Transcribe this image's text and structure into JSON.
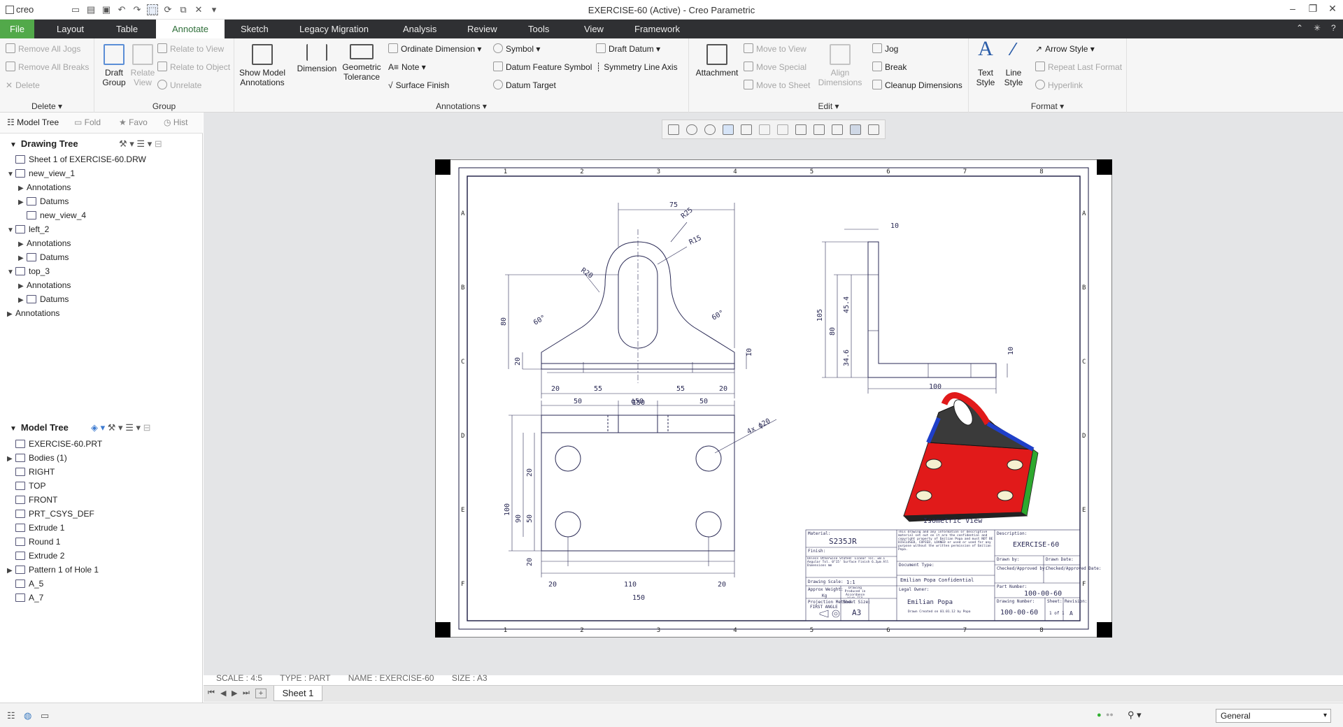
{
  "app": {
    "logo": "creo",
    "window_title": "EXERCISE-60 (Active) - Creo Parametric"
  },
  "ribbon_tabs": {
    "file": "File",
    "layout": "Layout",
    "table": "Table",
    "annotate": "Annotate",
    "sketch": "Sketch",
    "legacy": "Legacy Migration",
    "analysis": "Analysis",
    "review": "Review",
    "tools": "Tools",
    "view": "View",
    "framework": "Framework"
  },
  "ribbon": {
    "delete": {
      "remove_jogs": "Remove All Jogs",
      "remove_breaks": "Remove All Breaks",
      "delete": "Delete",
      "label": "Delete"
    },
    "group": {
      "draft_group": "Draft\nGroup",
      "relate_view": "Relate\nView",
      "relate_to_view": "Relate to View",
      "relate_to_object": "Relate to Object",
      "unrelate": "Unrelate",
      "label": "Group"
    },
    "annotations": {
      "show_model": "Show Model\nAnnotations",
      "dimension": "Dimension",
      "geom_tol": "Geometric\nTolerance",
      "ordinate": "Ordinate Dimension",
      "note": "Note",
      "surface_finish": "Surface Finish",
      "symbol": "Symbol",
      "datum_feature": "Datum Feature Symbol",
      "datum_target": "Datum Target",
      "draft_datum": "Draft Datum",
      "symmetry": "Symmetry Line Axis",
      "label": "Annotations"
    },
    "edit": {
      "attachment": "Attachment",
      "move_to_view": "Move to View",
      "move_special": "Move Special",
      "move_to_sheet": "Move to Sheet",
      "align": "Align\nDimensions",
      "jog": "Jog",
      "break": "Break",
      "cleanup": "Cleanup Dimensions",
      "label": "Edit"
    },
    "format": {
      "text_style": "Text\nStyle",
      "line_style": "Line\nStyle",
      "arrow_style": "Arrow Style",
      "repeat_last": "Repeat Last Format",
      "hyperlink": "Hyperlink",
      "label": "Format"
    }
  },
  "left_panel": {
    "tabs": {
      "model_tree": "Model Tree",
      "folder": "Fold",
      "favorites": "Favo",
      "history": "Hist"
    },
    "drawing_tree": {
      "title": "Drawing Tree",
      "items": [
        "Sheet 1 of EXERCISE-60.DRW",
        "new_view_1",
        "Annotations",
        "Datums",
        "new_view_4",
        "left_2",
        "Annotations",
        "Datums",
        "top_3",
        "Annotations",
        "Datums",
        "Annotations"
      ]
    },
    "model_tree": {
      "title": "Model Tree",
      "items": [
        "EXERCISE-60.PRT",
        "Bodies (1)",
        "RIGHT",
        "TOP",
        "FRONT",
        "PRT_CSYS_DEF",
        "Extrude 1",
        "Round 1",
        "Extrude 2",
        "Pattern 1 of Hole 1",
        "A_5",
        "A_7"
      ]
    }
  },
  "drawing": {
    "cols": [
      "1",
      "2",
      "3",
      "4",
      "5",
      "6",
      "7",
      "8"
    ],
    "rows": [
      "A",
      "B",
      "C",
      "D",
      "E",
      "F"
    ],
    "front_dims": {
      "d75": "75",
      "r25": "R25",
      "r15": "R15",
      "r20": "R20",
      "a60l": "60°",
      "a60r": "60°",
      "d80": "80",
      "d20": "20",
      "d10": "10",
      "b20a": "20",
      "b55a": "55",
      "b55b": "55",
      "b20b": "20",
      "d150": "150"
    },
    "side_dims": {
      "d10": "10",
      "d105": "105",
      "d80": "80",
      "d45": "45.4",
      "d34": "34.6",
      "d10b": "10",
      "d100": "100"
    },
    "top_dims": {
      "d50a": "50",
      "phi50": "ϕ50",
      "d50b": "50",
      "holes": "4x ϕ20",
      "d20a": "20",
      "d50": "50",
      "d20b": "20",
      "d90": "90",
      "d100": "100",
      "b20a": "20",
      "b110": "110",
      "b20b": "20",
      "b150": "150"
    },
    "iso_label": "Isometric View",
    "title_block": {
      "material_label": "Material:",
      "material": "S235JR",
      "finish_label": "Finish:",
      "notice": "This drawing and any information or descriptive material set out on it are the confidential and copyright property of Emilian Popa and must NOT BE DISCLOSED, COPIED, LOANED or used or used for any purpose without the written permission of Emilian Popa.",
      "tolerance": "Unless Otherwise Stated: Linear Tol. ±0.1 Angular Tol. 0°15' Surface Finish 6.3µm All Dimensions mm",
      "doc_type": "Document Type:",
      "confidential": "Emilian Popa Confidential",
      "legal_owner": "Legal Owner:",
      "owner": "Emilian Popa",
      "owner_note": "Drawn Created on 01.01.12 by Popa",
      "drawing_scale": "Drawing Scale:",
      "scale": "1:1",
      "weight_label": "Approx Weight:",
      "weight": "Kg",
      "produced": "Drawing Produced in Accordance With ISO",
      "projection": "Projection Method",
      "first_angle": "FIRST ANGLE",
      "sheet_size_label": "Sheet Size:",
      "sheet_size": "A3",
      "description_label": "Description:",
      "description": "EXERCISE-60",
      "drawn_by": "Drawn by:",
      "drawn_date": "Drawn Date:",
      "checked": "Checked/Approved by:",
      "checked_date": "Checked/Approved Date:",
      "part_number_label": "Part Number:",
      "part_number": "100-00-60",
      "drawing_number_label": "Drawing Number:",
      "drawing_number": "100-00-60",
      "sheet_label": "Sheet:",
      "sheet_of": "1 of 1",
      "revision_label": "Revision:",
      "revision": "A"
    }
  },
  "status_info": {
    "scale": "SCALE : 4:5",
    "type": "TYPE : PART",
    "name": "NAME : EXERCISE-60",
    "size": "SIZE : A3"
  },
  "sheet_tab": "Sheet 1",
  "status_bar": {
    "filter": "General"
  }
}
